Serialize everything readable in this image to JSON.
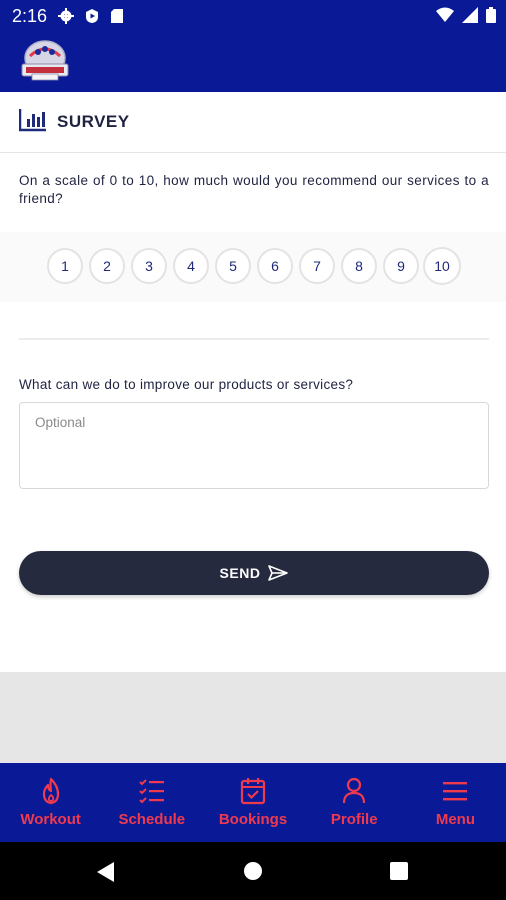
{
  "status": {
    "time": "2:16",
    "left_icons": [
      "gear-icon",
      "shield-play-icon",
      "sd-card-icon"
    ],
    "right_icons": [
      "wifi-icon",
      "signal-icon",
      "battery-icon"
    ]
  },
  "appbar": {
    "logo": "brand-logo"
  },
  "survey": {
    "title": "SURVEY",
    "question_1": "On a scale of 0 to 10, how much would you recommend our services to a friend?",
    "scale": [
      "1",
      "2",
      "3",
      "4",
      "5",
      "6",
      "7",
      "8",
      "9",
      "10"
    ],
    "question_2": "What can we do to improve our products or services?",
    "feedback_placeholder": "Optional",
    "send_label": "SEND"
  },
  "bottom_nav": {
    "items": [
      {
        "label": "Workout",
        "icon": "flame-icon"
      },
      {
        "label": "Schedule",
        "icon": "checklist-icon"
      },
      {
        "label": "Bookings",
        "icon": "calendar-check-icon"
      },
      {
        "label": "Profile",
        "icon": "person-icon"
      },
      {
        "label": "Menu",
        "icon": "hamburger-icon"
      }
    ]
  },
  "colors": {
    "brand_blue": "#0a1a96",
    "accent_red": "#ef3a4e",
    "button_dark": "#252a3e"
  }
}
